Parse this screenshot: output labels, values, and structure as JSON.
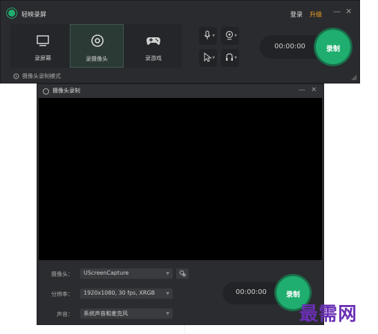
{
  "app": {
    "title": "轻映录屏",
    "login": "登录",
    "upgrade": "升级",
    "minimize": "—",
    "close": "✕"
  },
  "modes": [
    {
      "label": "录屏幕",
      "icon": "monitor-icon",
      "active": false
    },
    {
      "label": "录摄像头",
      "icon": "webcam-icon",
      "active": true
    },
    {
      "label": "录游戏",
      "icon": "gamepad-icon",
      "active": false
    }
  ],
  "controls": {
    "icons": [
      "microphone-icon",
      "camera-settings-icon",
      "cursor-icon",
      "speaker-icon"
    ],
    "timer": "00:00:00",
    "record": "录制"
  },
  "camera_mode_label": "摄像头录制模式",
  "camera_window": {
    "title": "摄像头录制",
    "minimize": "—",
    "close": "✕",
    "fields": {
      "camera_label": "摄像头：",
      "camera_value": "UScreenCapture",
      "resolution_label": "分辨率：",
      "resolution_value": "1920x1080, 30 fps, XRGB",
      "audio_label": "声音：",
      "audio_value": "系统声音和麦克风"
    },
    "timer": "00:00:00",
    "record": "录制"
  },
  "watermark": "最需网",
  "colors": {
    "accent": "#1fae6f",
    "upgrade": "#f5a623",
    "window_bg": "#2a2b2e",
    "watermark": "#6a2fb5"
  }
}
